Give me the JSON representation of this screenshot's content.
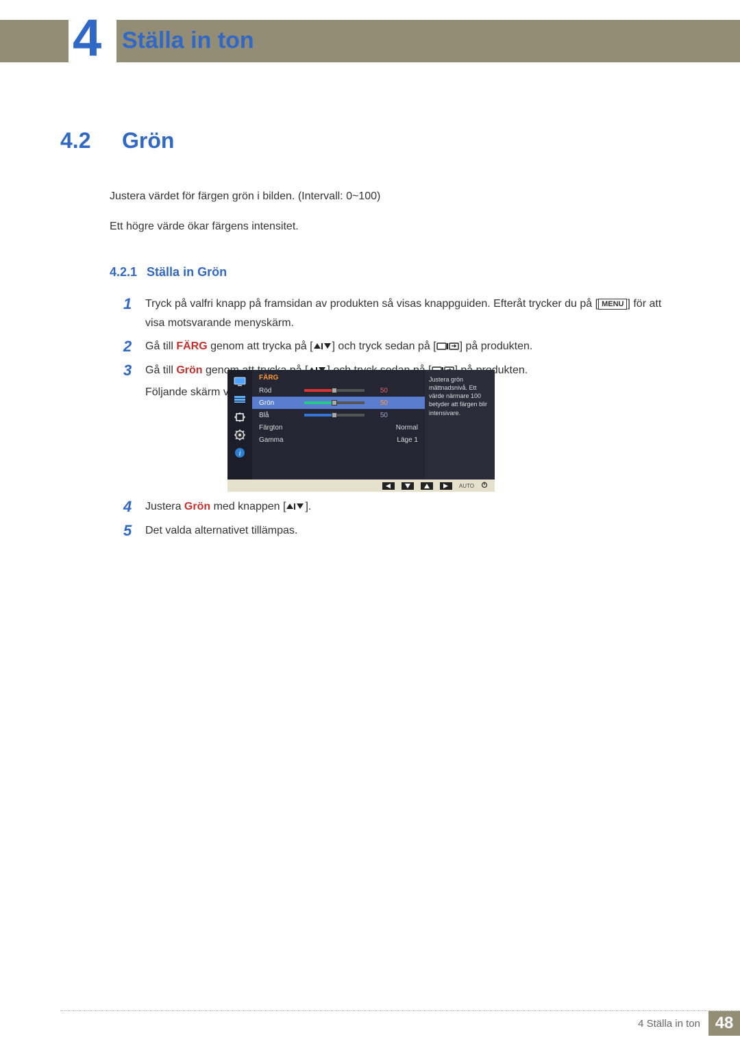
{
  "chapter": {
    "number": "4",
    "title": "Ställa in ton"
  },
  "section": {
    "number": "4.2",
    "title": "Grön"
  },
  "intro": {
    "line1": "Justera värdet för färgen grön i bilden. (Intervall: 0~100)",
    "line2": "Ett högre värde ökar färgens intensitet."
  },
  "subsection": {
    "number": "4.2.1",
    "title": "Ställa in Grön"
  },
  "steps": {
    "s1_a": "Tryck på valfri knapp på framsidan av produkten så visas knappguiden. Efteråt trycker du på [",
    "s1_b": "] för att visa motsvarande menyskärm.",
    "menu_label": "MENU",
    "s2_a": "Gå till ",
    "s2_kw": "FÄRG",
    "s2_b": " genom att trycka på [",
    "s2_c": "] och tryck sedan på [",
    "s2_d": "] på produkten.",
    "s3_a": "Gå till ",
    "s3_kw": "Grön",
    "s3_b": " genom att trycka på [",
    "s3_c": "] och tryck sedan på [",
    "s3_d": "] på produkten.",
    "s3_e": "Följande skärm visas.",
    "s4_a": "Justera ",
    "s4_kw": "Grön",
    "s4_b": " med knappen [",
    "s4_c": "].",
    "s5": "Det valda alternativet tillämpas."
  },
  "osd": {
    "title": "FÄRG",
    "red": {
      "label": "Röd",
      "value": "50"
    },
    "green": {
      "label": "Grön",
      "value": "50"
    },
    "blue": {
      "label": "Blå",
      "value": "50"
    },
    "tone": {
      "label": "Färgton",
      "value": "Normal"
    },
    "gamma": {
      "label": "Gamma",
      "value": "Läge 1"
    },
    "help": "Justera grön mättnadsnivå. Ett värde närmare 100 betyder att färgen blir intensivare.",
    "auto": "AUTO"
  },
  "footer": {
    "label": "4 Ställa in ton",
    "page": "48"
  }
}
